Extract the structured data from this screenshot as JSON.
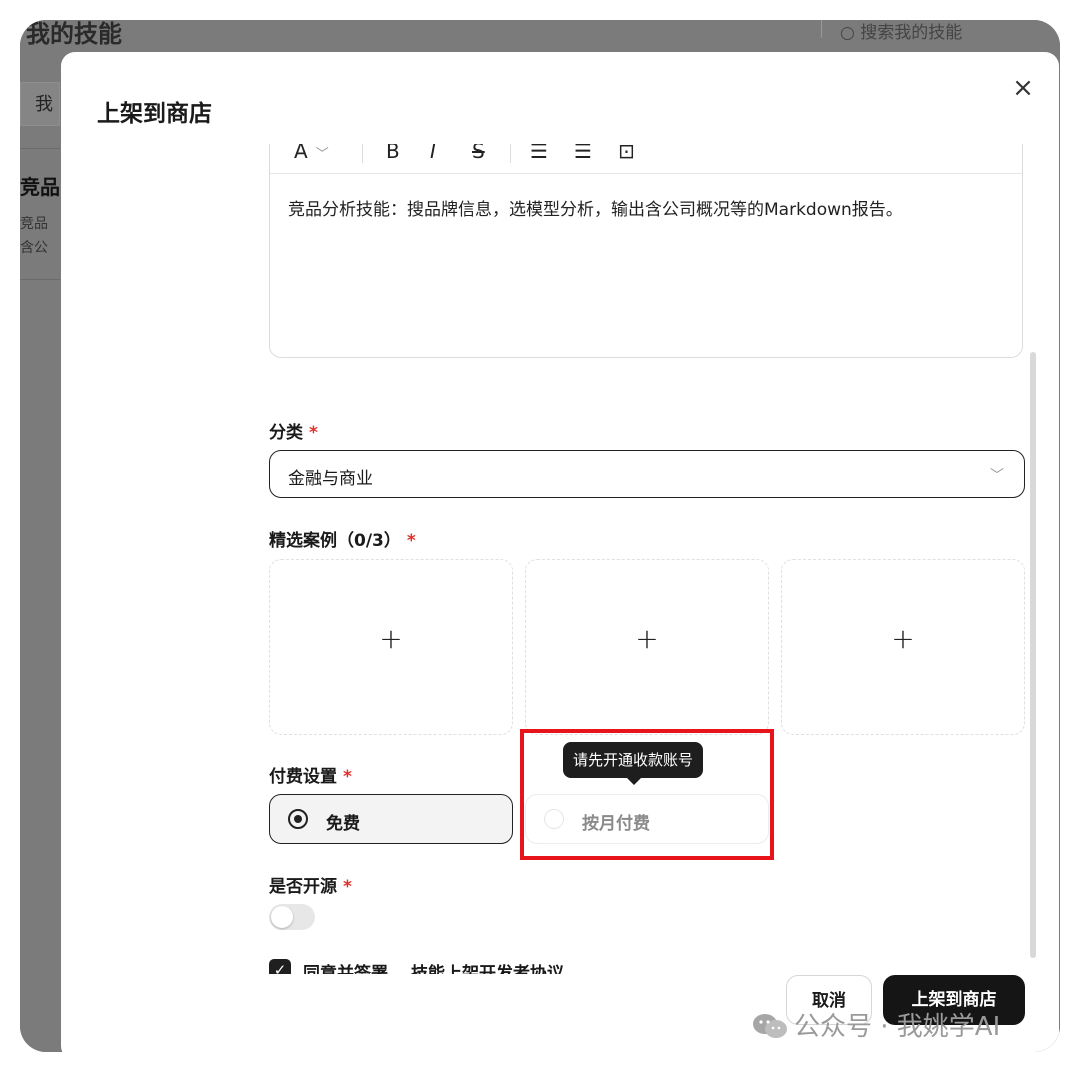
{
  "background": {
    "title": "我的技能",
    "search_placeholder": "搜索我的技能",
    "tab_label": "我",
    "card_title": "竞品",
    "card_desc_1": "竞品",
    "card_desc_2": "含公"
  },
  "modal": {
    "title": "上架到商店",
    "close_label": "×"
  },
  "editor": {
    "toolbar": {
      "font_label": "A",
      "bold": "B",
      "italic": "I",
      "strike": "S",
      "bullet_list": "☰",
      "numbered_list": "☰",
      "image": "⊡"
    },
    "content": "竞品分析技能：搜品牌信息，选模型分析，输出含公司概况等的Markdown报告。"
  },
  "category": {
    "label": "分类",
    "required": "*",
    "value": "金融与商业"
  },
  "cases": {
    "label": "精选案例（0/3）",
    "required": "*",
    "slots": [
      "+",
      "+",
      "+"
    ]
  },
  "pricing": {
    "label": "付费设置",
    "required": "*",
    "options": [
      {
        "label": "免费",
        "selected": true
      },
      {
        "label": "按月付费",
        "selected": false,
        "disabled": true
      }
    ],
    "tooltip": "请先开通收款账号"
  },
  "open_source": {
    "label": "是否开源",
    "required": "*",
    "enabled": false
  },
  "agreement": {
    "checked": true,
    "text": "同意并签署",
    "link": "技能上架开发者协议"
  },
  "footer": {
    "cancel": "取消",
    "submit": "上架到商店"
  },
  "watermark": "公众号 · 我姚学AI",
  "colors": {
    "accent_dark": "#151515",
    "required_red": "#e0302a",
    "highlight_red": "#e8141b"
  }
}
